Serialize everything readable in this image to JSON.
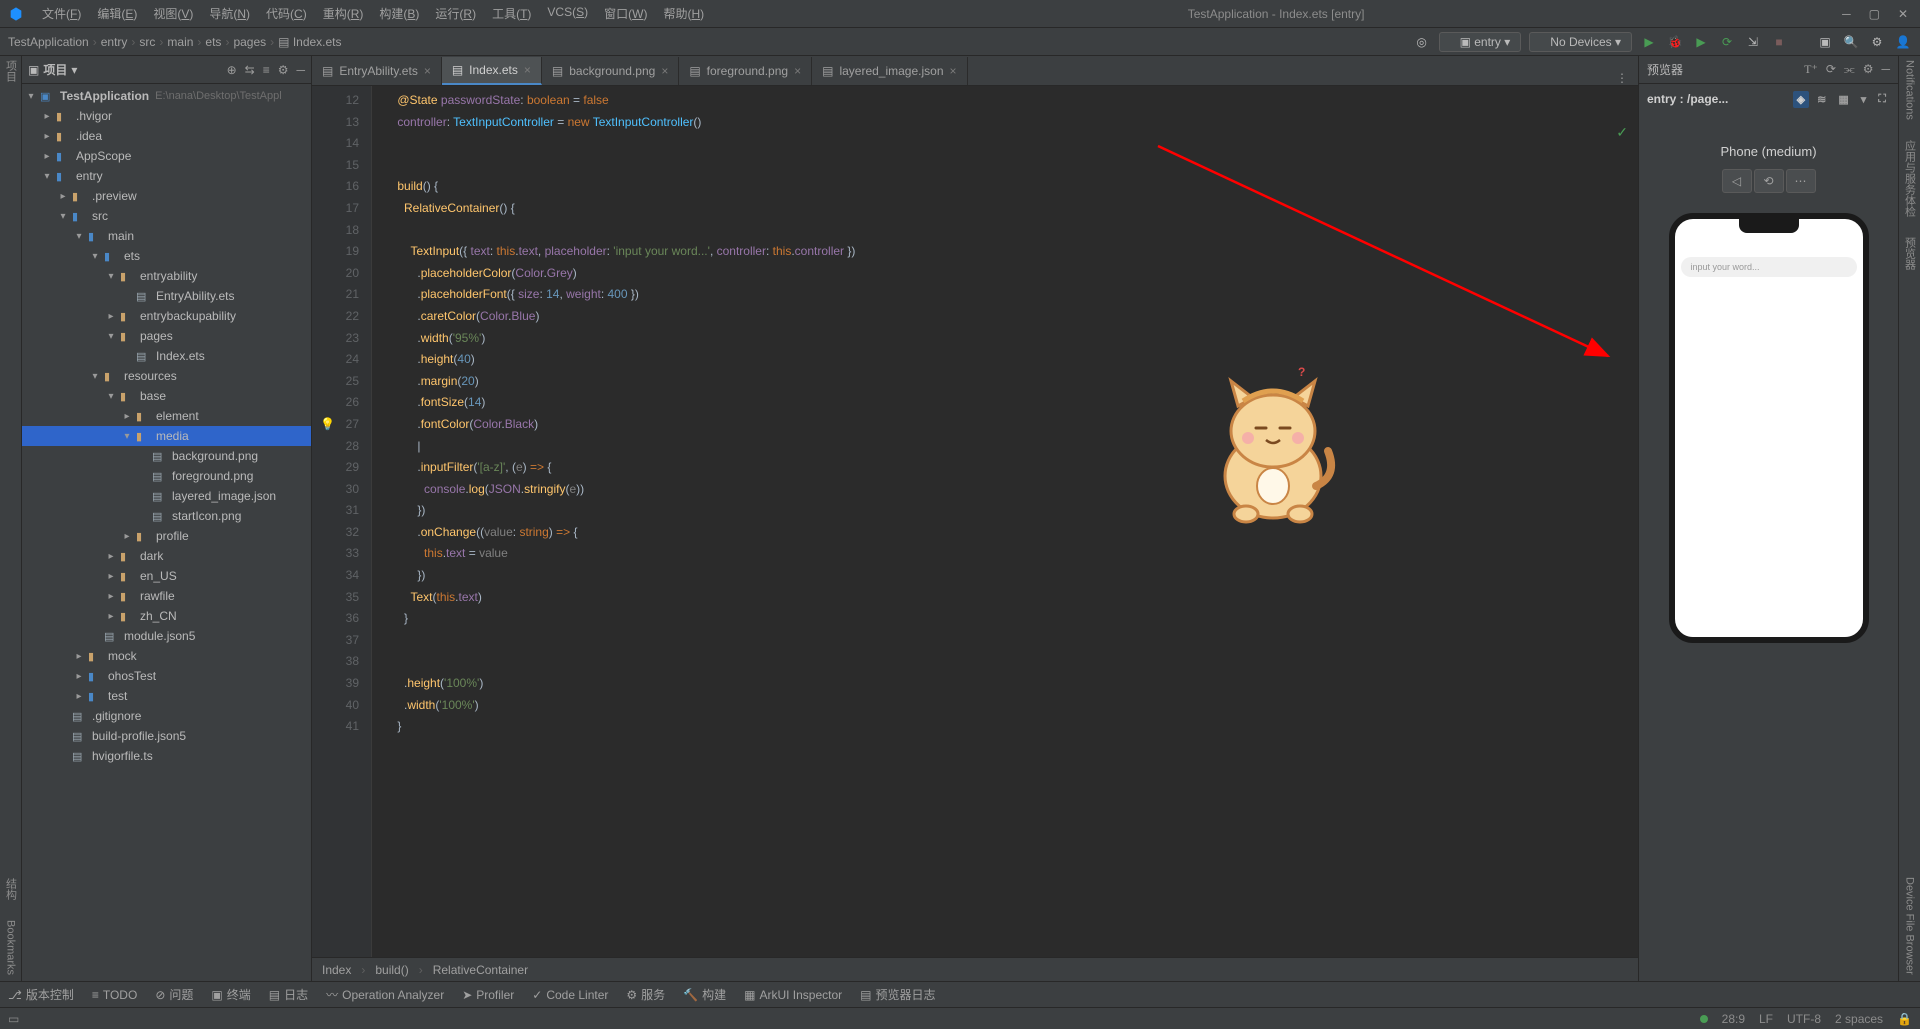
{
  "window": {
    "title": "TestApplication - Index.ets [entry]"
  },
  "menu": [
    "文件(F)",
    "编辑(E)",
    "视图(V)",
    "导航(N)",
    "代码(C)",
    "重构(R)",
    "构建(B)",
    "运行(R)",
    "工具(T)",
    "VCS(S)",
    "窗口(W)",
    "帮助(H)"
  ],
  "breadcrumbs": [
    "TestApplication",
    "entry",
    "src",
    "main",
    "ets",
    "pages",
    "Index.ets"
  ],
  "runConfig": {
    "module": "entry",
    "device": "No Devices"
  },
  "sidebar": {
    "title": "项目",
    "root": {
      "name": "TestApplication",
      "path": "E:\\nana\\Desktop\\TestAppl"
    },
    "nodes": [
      {
        "d": 1,
        "t": "folder",
        "o": false,
        "n": ".hvigor",
        "cls": "folder"
      },
      {
        "d": 1,
        "t": "folder",
        "o": false,
        "n": ".idea",
        "cls": "folder"
      },
      {
        "d": 1,
        "t": "folder",
        "o": false,
        "n": "AppScope",
        "cls": "folder mod"
      },
      {
        "d": 1,
        "t": "folder",
        "o": true,
        "n": "entry",
        "cls": "folder mod"
      },
      {
        "d": 2,
        "t": "folder",
        "o": false,
        "n": ".preview",
        "cls": "folder"
      },
      {
        "d": 2,
        "t": "folder",
        "o": true,
        "n": "src",
        "cls": "folder mod"
      },
      {
        "d": 3,
        "t": "folder",
        "o": true,
        "n": "main",
        "cls": "folder mod"
      },
      {
        "d": 4,
        "t": "folder",
        "o": true,
        "n": "ets",
        "cls": "folder mod"
      },
      {
        "d": 5,
        "t": "folder",
        "o": true,
        "n": "entryability",
        "cls": "folder"
      },
      {
        "d": 6,
        "t": "file",
        "n": "EntryAbility.ets"
      },
      {
        "d": 5,
        "t": "folder",
        "o": false,
        "n": "entrybackupability",
        "cls": "folder"
      },
      {
        "d": 5,
        "t": "folder",
        "o": true,
        "n": "pages",
        "cls": "folder"
      },
      {
        "d": 6,
        "t": "file",
        "n": "Index.ets"
      },
      {
        "d": 4,
        "t": "folder",
        "o": true,
        "n": "resources",
        "cls": "folder"
      },
      {
        "d": 5,
        "t": "folder",
        "o": true,
        "n": "base",
        "cls": "folder"
      },
      {
        "d": 6,
        "t": "folder",
        "o": false,
        "n": "element",
        "cls": "folder"
      },
      {
        "d": 6,
        "t": "folder",
        "o": true,
        "n": "media",
        "cls": "folder",
        "sel": true
      },
      {
        "d": 7,
        "t": "file",
        "n": "background.png"
      },
      {
        "d": 7,
        "t": "file",
        "n": "foreground.png"
      },
      {
        "d": 7,
        "t": "file",
        "n": "layered_image.json"
      },
      {
        "d": 7,
        "t": "file",
        "n": "startIcon.png"
      },
      {
        "d": 6,
        "t": "folder",
        "o": false,
        "n": "profile",
        "cls": "folder"
      },
      {
        "d": 5,
        "t": "folder",
        "o": false,
        "n": "dark",
        "cls": "folder"
      },
      {
        "d": 5,
        "t": "folder",
        "o": false,
        "n": "en_US",
        "cls": "folder"
      },
      {
        "d": 5,
        "t": "folder",
        "o": false,
        "n": "rawfile",
        "cls": "folder"
      },
      {
        "d": 5,
        "t": "folder",
        "o": false,
        "n": "zh_CN",
        "cls": "folder"
      },
      {
        "d": 4,
        "t": "file",
        "n": "module.json5"
      },
      {
        "d": 3,
        "t": "folder",
        "o": false,
        "n": "mock",
        "cls": "folder"
      },
      {
        "d": 3,
        "t": "folder",
        "o": false,
        "n": "ohosTest",
        "cls": "folder mod"
      },
      {
        "d": 3,
        "t": "folder",
        "o": false,
        "n": "test",
        "cls": "folder mod"
      },
      {
        "d": 2,
        "t": "file",
        "n": ".gitignore"
      },
      {
        "d": 2,
        "t": "file",
        "n": "build-profile.json5"
      },
      {
        "d": 2,
        "t": "file",
        "n": "hvigorfile.ts"
      }
    ]
  },
  "tabs": [
    {
      "n": "EntryAbility.ets",
      "active": false
    },
    {
      "n": "Index.ets",
      "active": true
    },
    {
      "n": "background.png",
      "active": false
    },
    {
      "n": "foreground.png",
      "active": false
    },
    {
      "n": "layered_image.json",
      "active": false
    }
  ],
  "lineStart": 12,
  "lineEnd": 41,
  "bulbLine": 27,
  "code": [
    "    <span class='k-yellow'>@State</span> <span class='k-purple'>passwordState</span>: <span class='k-orange'>boolean</span> = <span class='k-orange'>false</span>",
    "    <span class='k-purple'>controller</span>: <span class='k-bluebr'>TextInputController</span> = <span class='k-orange'>new</span> <span class='k-bluebr'>TextInputController</span>()",
    "",
    "",
    "    <span class='k-yellow'>build</span>() {",
    "      <span class='k-yellow'>RelativeContainer</span>() {",
    "",
    "        <span class='k-yellow'>TextInput</span>({ <span class='k-purple'>text</span>: <span class='k-orange'>this</span>.<span class='k-purple'>text</span>, <span class='k-purple'>placeholder</span>: <span class='k-green'>'input your word...'</span>, <span class='k-purple'>controller</span>: <span class='k-orange'>this</span>.<span class='k-purple'>controller</span> })",
    "          .<span class='k-yellow'>placeholderColor</span>(<span class='k-purple'>Color</span>.<span class='k-purple'>Grey</span>)",
    "          .<span class='k-yellow'>placeholderFont</span>({ <span class='k-purple'>size</span>: <span class='k-blue'>14</span>, <span class='k-purple'>weight</span>: <span class='k-blue'>400</span> })",
    "          .<span class='k-yellow'>caretColor</span>(<span class='k-purple'>Color</span>.<span class='k-purple'>Blue</span>)",
    "          .<span class='k-yellow'>width</span>(<span class='k-green'>'95%'</span>)",
    "          .<span class='k-yellow'>height</span>(<span class='k-blue'>40</span>)",
    "          .<span class='k-yellow'>margin</span>(<span class='k-blue'>20</span>)",
    "          .<span class='k-yellow'>fontSize</span>(<span class='k-blue'>14</span>)",
    "          .<span class='k-yellow'>fontColor</span>(<span class='k-purple'>Color</span>.<span class='k-purple'>Black</span>)",
    "          |",
    "          .<span class='k-yellow'>inputFilter</span>(<span class='k-green'>'[a-z]'</span>, (<span class='k-gray'>e</span>) <span class='k-orange'>=&gt;</span> {",
    "            <span class='k-purple'>console</span>.<span class='k-yellow'>log</span>(<span class='k-purple'>JSON</span>.<span class='k-yellow'>stringify</span>(<span class='k-gray'>e</span>))",
    "          })",
    "          .<span class='k-yellow'>onChange</span>((<span class='k-gray'>value</span>: <span class='k-orange'>string</span>) <span class='k-orange'>=&gt;</span> {",
    "            <span class='k-orange'>this</span>.<span class='k-purple'>text</span> = <span class='k-gray'>value</span>",
    "          })",
    "        <span class='k-yellow'>Text</span>(<span class='k-orange'>this</span>.<span class='k-purple'>text</span>)",
    "      }",
    "",
    "",
    "      .<span class='k-yellow'>height</span>(<span class='k-green'>'100%'</span>)",
    "      .<span class='k-yellow'>width</span>(<span class='k-green'>'100%'</span>)",
    "    }"
  ],
  "codeCrumbs": [
    "Index",
    "build()",
    "RelativeContainer"
  ],
  "preview": {
    "title": "预览器",
    "entry": "entry : /page...",
    "device": "Phone (medium)",
    "placeholder": "input your word..."
  },
  "bottombar": [
    "版本控制",
    "TODO",
    "问题",
    "终端",
    "日志",
    "Operation Analyzer",
    "Profiler",
    "Code Linter",
    "服务",
    "构建",
    "ArkUI Inspector",
    "预览器日志"
  ],
  "status": {
    "pos": "28:9",
    "lf": "LF",
    "enc": "UTF-8",
    "indent": "2 spaces"
  },
  "leftTools": [
    "项目",
    "结构",
    "Bookmarks"
  ],
  "rightTools": [
    "Notifications",
    "应用与服务体检",
    "预览器",
    "Device File Browser"
  ]
}
